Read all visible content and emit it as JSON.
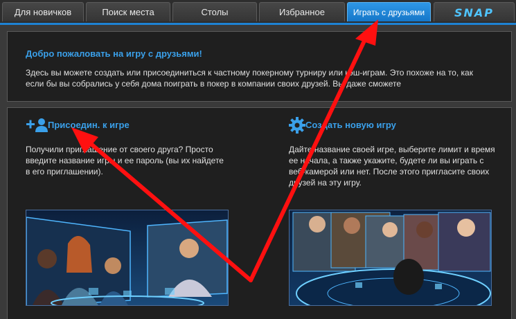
{
  "tabs": [
    {
      "label": "Для новичков"
    },
    {
      "label": "Поиск места"
    },
    {
      "label": "Столы"
    },
    {
      "label": "Избранное"
    },
    {
      "label": "Играть с друзьями",
      "active": true
    }
  ],
  "logo": {
    "text": "SNAP"
  },
  "welcome": {
    "title": "Добро пожаловать на игру с друзьями!",
    "text": "Здесь вы можете создать или присоединиться к частному покерному турниру или кэш-играм. Это похоже на то, как если бы вы собрались у себя дома поиграть в покер в компании своих друзей. Вы даже сможете"
  },
  "join": {
    "title": "Присоедин. к игре",
    "text": "Получили приглашение от своего друга? Просто введите название игры и ее пароль (вы их найдете в его приглашении).",
    "icon": "add-user-icon"
  },
  "create": {
    "title": "Создать новую игру",
    "text": "Дайте название своей игре, выберите лимит и время ее начала, а также укажите, будете ли вы играть с веб-камерой или нет. После этого пригласите своих друзей на эту игру.",
    "icon": "gear-icon"
  },
  "colors": {
    "accent": "#3aa0ea",
    "active_tab": "#1f87d8",
    "annotation_arrow": "#ff1010"
  }
}
